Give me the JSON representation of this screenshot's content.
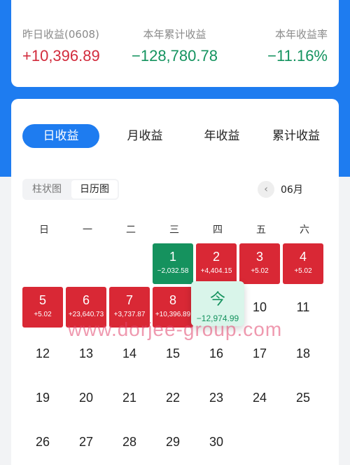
{
  "summary": {
    "yesterday": {
      "label": "昨日收益(0608)",
      "value": "+10,396.89"
    },
    "ytd": {
      "label": "本年累计收益",
      "value": "−128,780.78"
    },
    "ytd_rate": {
      "label": "本年收益率",
      "value": "−11.16%"
    }
  },
  "tabs": [
    "日收益",
    "月收益",
    "年收益",
    "累计收益"
  ],
  "view_toggle": {
    "bar": "柱状图",
    "calendar": "日历图"
  },
  "month_nav": {
    "prev_icon": "‹",
    "label": "06月"
  },
  "weekdays": [
    "日",
    "一",
    "二",
    "三",
    "四",
    "五",
    "六"
  ],
  "days": {
    "d1": {
      "day": "1",
      "value": "−2,032.58"
    },
    "d2": {
      "day": "2",
      "value": "+4,404.15"
    },
    "d3": {
      "day": "3",
      "value": "+5.02"
    },
    "d4": {
      "day": "4",
      "value": "+5.02"
    },
    "d5": {
      "day": "5",
      "value": "+5.02"
    },
    "d6": {
      "day": "6",
      "value": "+23,640.73"
    },
    "d7": {
      "day": "7",
      "value": "+3,737.87"
    },
    "d8": {
      "day": "8",
      "value": "+10,396.89"
    },
    "today": {
      "day": "今",
      "value": "−12,974.99"
    },
    "d10": "10",
    "d11": "11",
    "d12": "12",
    "d13": "13",
    "d14": "14",
    "d15": "15",
    "d16": "16",
    "d17": "17",
    "d18": "18",
    "d19": "19",
    "d20": "20",
    "d21": "21",
    "d22": "22",
    "d23": "23",
    "d24": "24",
    "d25": "25",
    "d26": "26",
    "d27": "27",
    "d28": "28",
    "d29": "29",
    "d30": "30"
  },
  "watermark": "www.dorjee-group.com",
  "colors": {
    "accent": "#1e7cf0",
    "gain": "#d92835",
    "loss": "#15925e"
  }
}
